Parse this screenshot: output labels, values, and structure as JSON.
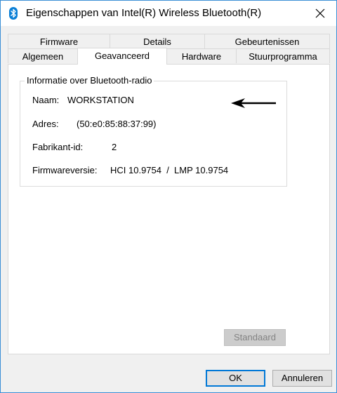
{
  "window": {
    "title": "Eigenschappen van Intel(R) Wireless Bluetooth(R)"
  },
  "tabs": {
    "row1": [
      {
        "label": "Firmware"
      },
      {
        "label": "Details"
      },
      {
        "label": "Gebeurtenissen"
      }
    ],
    "row2": [
      {
        "label": "Algemeen"
      },
      {
        "label": "Geavanceerd",
        "active": true
      },
      {
        "label": "Hardware"
      },
      {
        "label": "Stuurprogramma"
      }
    ]
  },
  "group": {
    "legend": "Informatie over Bluetooth-radio",
    "rows": [
      {
        "label": "Naam:",
        "value": "WORKSTATION"
      },
      {
        "label": "Adres:",
        "value": "(50:e0:85:88:37:99)"
      },
      {
        "label": "Fabrikant-id:",
        "value": "2"
      },
      {
        "label": "Firmwareversie:",
        "value": "HCI 10.9754  /  LMP 10.9754"
      }
    ]
  },
  "buttons": {
    "default_label": "Standaard",
    "ok_label": "OK",
    "cancel_label": "Annuleren"
  },
  "icons": {
    "title": "bluetooth-icon",
    "close": "close-icon",
    "annotation": "arrow-left-icon"
  },
  "colors": {
    "bluetooth_blue": "#0a7fd6",
    "focus_border": "#0078d7"
  }
}
